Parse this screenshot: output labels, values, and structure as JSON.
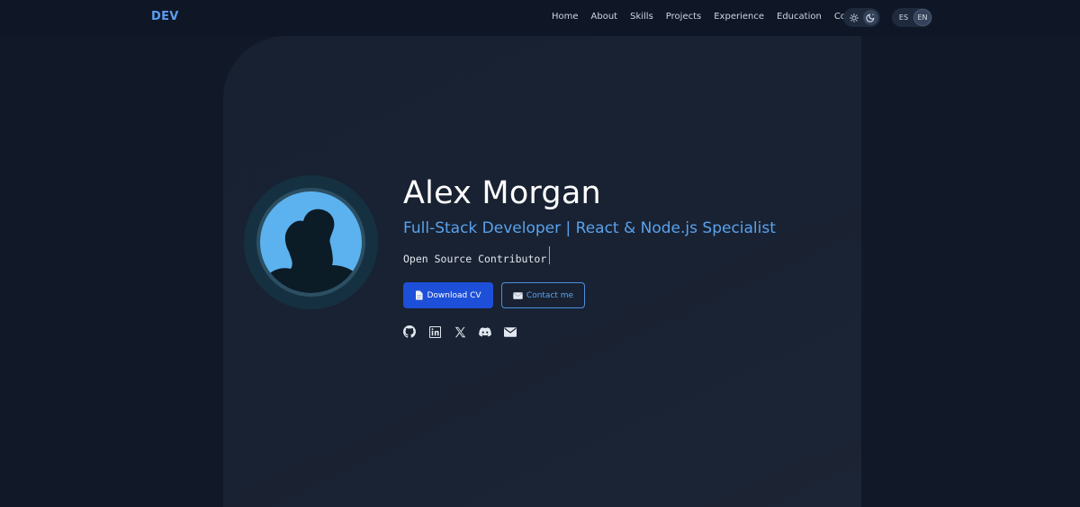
{
  "header": {
    "logo": "DEV",
    "nav": [
      "Home",
      "About",
      "Skills",
      "Projects",
      "Experience",
      "Education",
      "Contact"
    ],
    "theme": {
      "options": [
        "sun-icon",
        "moon-icon"
      ],
      "active": "moon-icon"
    },
    "language": {
      "options": [
        "ES",
        "EN"
      ],
      "active": "EN"
    }
  },
  "hero": {
    "name": "Alex Morgan",
    "role": "Full-Stack Developer | React & Node.js Specialist",
    "tagline": "Open Source Contributor",
    "buttons": {
      "download_cv": "Download CV",
      "contact_me": "Contact me"
    },
    "socials": [
      "github-icon",
      "linkedin-icon",
      "x-icon",
      "discord-icon",
      "mail-icon"
    ]
  },
  "colors": {
    "background": "#111827",
    "accent": "#5aa2ee",
    "primary_button": "#1d4fd8",
    "avatar_bg": "#5cb2ee"
  }
}
